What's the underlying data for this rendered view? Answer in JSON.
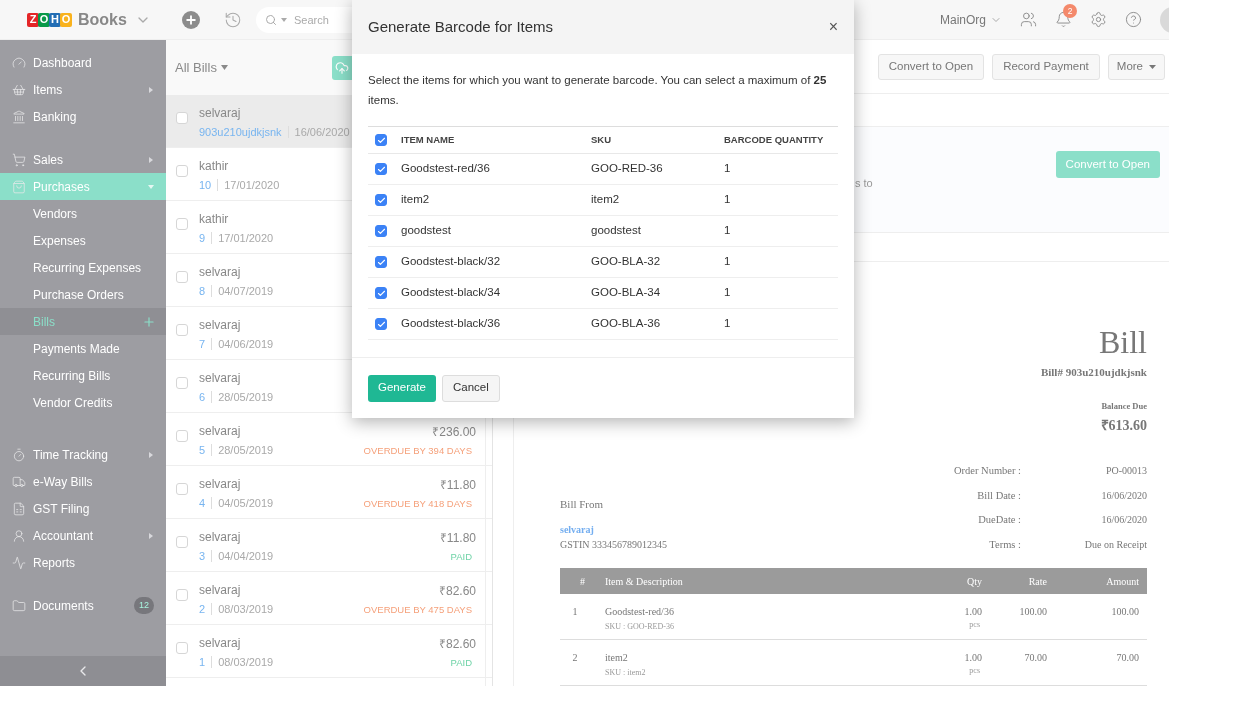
{
  "brand": {
    "letters": [
      {
        "text": "Z",
        "color": "#e42527"
      },
      {
        "text": "O",
        "color": "#089949"
      },
      {
        "text": "H",
        "color": "#226db4"
      },
      {
        "text": "O",
        "color": "#f9b21d"
      }
    ],
    "product": "Books"
  },
  "topbar": {
    "search": {
      "placeholder": "Search"
    },
    "org": "MainOrg",
    "notifications": "2"
  },
  "sidebar": {
    "groups": [
      [
        {
          "label": "Dashboard",
          "selected": false
        },
        {
          "label": "Items",
          "selected": false,
          "expanded": false
        },
        {
          "label": "Banking",
          "selected": false
        }
      ],
      [
        {
          "label": "Sales",
          "selected": false,
          "expanded": false
        },
        {
          "label": "Purchases",
          "selected": true,
          "expanded": true,
          "children": [
            {
              "label": "Vendors",
              "selected": false
            },
            {
              "label": "Expenses",
              "selected": false
            },
            {
              "label": "Recurring Expenses",
              "selected": false
            },
            {
              "label": "Purchase Orders",
              "selected": false
            },
            {
              "label": "Bills",
              "selected": true
            },
            {
              "label": "Payments Made",
              "selected": false
            },
            {
              "label": "Recurring Bills",
              "selected": false
            },
            {
              "label": "Vendor Credits",
              "selected": false
            }
          ]
        }
      ],
      [
        {
          "label": "Time Tracking",
          "selected": false,
          "expanded": false
        },
        {
          "label": "e-Way Bills",
          "selected": false
        },
        {
          "label": "GST Filing",
          "selected": false
        },
        {
          "label": "Accountant",
          "selected": false,
          "expanded": false
        },
        {
          "label": "Reports",
          "selected": false
        }
      ],
      [
        {
          "label": "Documents",
          "selected": false,
          "badge": "12"
        }
      ]
    ]
  },
  "bill_list": {
    "filter": "All Bills",
    "rows": [
      {
        "vendor": "selvaraj",
        "number": "903u210ujdkjsnk",
        "date": "16/06/2020",
        "selected": true,
        "checked": false
      },
      {
        "vendor": "kathir",
        "number": "10",
        "date": "17/01/2020",
        "selected": false,
        "checked": false
      },
      {
        "vendor": "kathir",
        "number": "9",
        "date": "17/01/2020",
        "selected": false,
        "checked": false
      },
      {
        "vendor": "selvaraj",
        "number": "8",
        "date": "04/07/2019",
        "selected": false,
        "checked": false
      },
      {
        "vendor": "selvaraj",
        "number": "7",
        "date": "04/06/2019",
        "selected": false,
        "checked": false
      },
      {
        "vendor": "selvaraj",
        "number": "6",
        "date": "28/05/2019",
        "selected": false,
        "checked": false
      },
      {
        "vendor": "selvaraj",
        "number": "5",
        "date": "28/05/2019",
        "amount": "₹236.00",
        "status": {
          "text": "OVERDUE BY 394 DAYS",
          "kind": "overdue"
        },
        "selected": false,
        "checked": false
      },
      {
        "vendor": "selvaraj",
        "number": "4",
        "date": "04/05/2019",
        "amount": "₹11.80",
        "status": {
          "text": "OVERDUE BY 418 DAYS",
          "kind": "overdue"
        },
        "selected": false,
        "checked": false
      },
      {
        "vendor": "selvaraj",
        "number": "3",
        "date": "04/04/2019",
        "amount": "₹11.80",
        "status": {
          "text": "PAID",
          "kind": "paid"
        },
        "selected": false,
        "checked": false
      },
      {
        "vendor": "selvaraj",
        "number": "2",
        "date": "08/03/2019",
        "amount": "₹82.60",
        "status": {
          "text": "OVERDUE BY 475 DAYS",
          "kind": "overdue"
        },
        "selected": false,
        "checked": false
      },
      {
        "vendor": "selvaraj",
        "number": "1",
        "date": "08/03/2019",
        "amount": "₹82.60",
        "status": {
          "text": "PAID",
          "kind": "paid"
        },
        "selected": false,
        "checked": false
      }
    ]
  },
  "detail": {
    "actions": [
      "Convert to Open",
      "Record Payment"
    ],
    "more": "More",
    "banner": {
      "text": "s to",
      "button": "Convert to Open"
    },
    "document": {
      "title": "Bill",
      "number": "Bill# 903u210ujdkjsnk",
      "balance_label": "Balance Due",
      "balance": "₹613.60",
      "meta": [
        {
          "label": "Order Number :",
          "value": "PO-00013"
        },
        {
          "label": "Bill Date :",
          "value": "16/06/2020"
        },
        {
          "label": "DueDate :",
          "value": "16/06/2020"
        },
        {
          "label": "Terms :",
          "value": "Due on Receipt"
        }
      ],
      "from_label": "Bill From",
      "vendor": "selvaraj",
      "gstin": "GSTIN 333456789012345",
      "columns": [
        "#",
        "Item & Description",
        "Qty",
        "Rate",
        "Amount"
      ],
      "items": [
        {
          "index": "1",
          "name": "Goodstest-red/36",
          "sku": "SKU : GOO-RED-36",
          "qty": "1.00",
          "unit": "pcs",
          "rate": "100.00",
          "amount": "100.00"
        },
        {
          "index": "2",
          "name": "item2",
          "sku": "SKU : item2",
          "qty": "1.00",
          "unit": "pcs",
          "rate": "70.00",
          "amount": "70.00"
        }
      ]
    }
  },
  "modal": {
    "title": "Generate Barcode for Items",
    "close": "×",
    "description": "Select the items for which you want to generate barcode. You can select a maximum of **25** items.",
    "select_all": {
      "checked": true
    },
    "columns": [
      "ITEM NAME",
      "SKU",
      "BARCODE QUANTITY"
    ],
    "rows": [
      {
        "name": "Goodstest-red/36",
        "sku": "GOO-RED-36",
        "quantity": "1",
        "checked": true
      },
      {
        "name": "item2",
        "sku": "item2",
        "quantity": "1",
        "checked": true
      },
      {
        "name": "goodstest",
        "sku": "goodstest",
        "quantity": "1",
        "checked": true
      },
      {
        "name": "Goodstest-black/32",
        "sku": "GOO-BLA-32",
        "quantity": "1",
        "checked": true
      },
      {
        "name": "Goodstest-black/34",
        "sku": "GOO-BLA-34",
        "quantity": "1",
        "checked": true
      },
      {
        "name": "Goodstest-black/36",
        "sku": "GOO-BLA-36",
        "quantity": "1",
        "checked": true
      }
    ],
    "buttons": [
      "Generate",
      "Cancel"
    ]
  }
}
